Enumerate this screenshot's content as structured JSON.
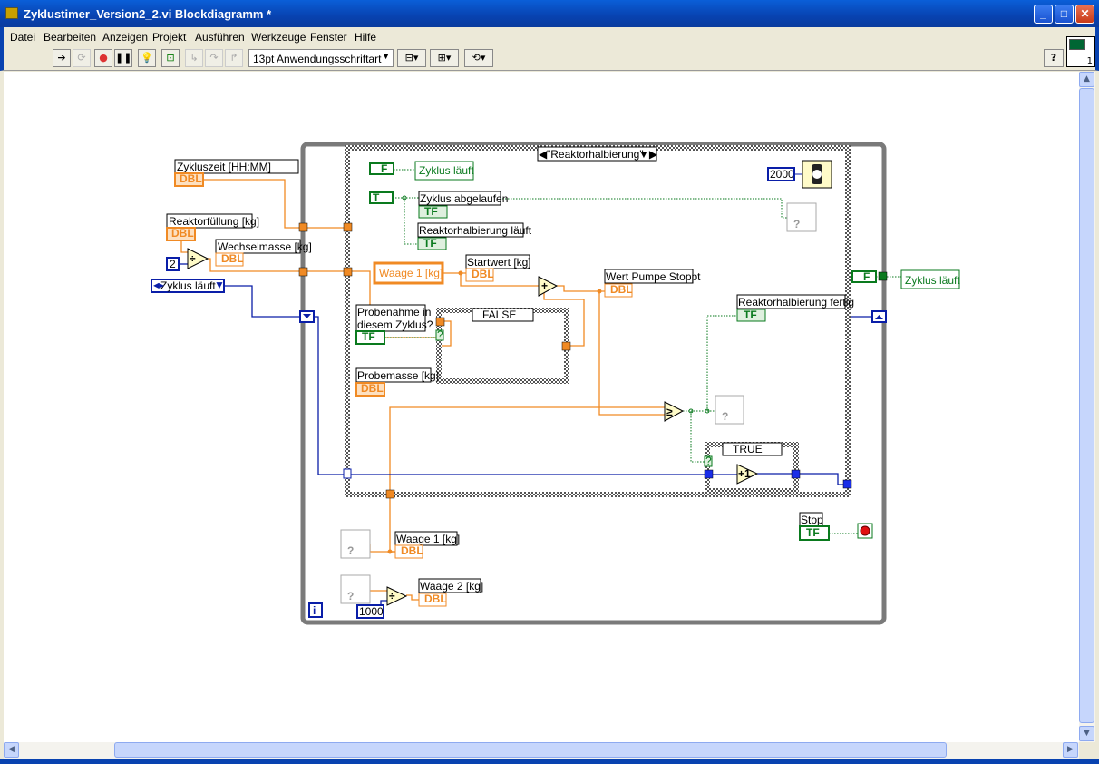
{
  "window": {
    "title": "Zyklustimer_Version2_2.vi Blockdiagramm *",
    "minimize": "_",
    "maximize": "□",
    "close": "✕"
  },
  "menu": [
    "Datei",
    "Bearbeiten",
    "Anzeigen",
    "Projekt",
    "Ausführen",
    "Werkzeuge",
    "Fenster",
    "Hilfe"
  ],
  "toolbar": {
    "font": "13pt Anwendungsschriftart",
    "help": "?",
    "connector_pane_number": "1",
    "icons": [
      "run-arrow-icon",
      "run-continuously-icon",
      "abort-icon",
      "pause-icon",
      "highlight-execution-icon",
      "retain-wire-values-icon",
      "step-into-icon",
      "step-over-icon",
      "step-out-icon",
      "align-icon",
      "distribute-icon",
      "reorder-icon"
    ]
  },
  "diagram": {
    "case_selector": "\"Reaktorhalbierung\"",
    "inner_case_false": "FALSE",
    "inner_case_true": "TRUE",
    "labels": {
      "zykluszeit": "Zykluszeit [HH:MM]",
      "reaktorfuellung": "Reaktorfüllung [kg]",
      "wechselmasse": "Wechselmasse [kg]",
      "zyklus_laeuft_enum": "Zyklus läuft",
      "zyklus_laeuft_local": "Zyklus läuft",
      "zyklus_abgelaufen": "Zyklus abgelaufen",
      "reaktorhalbierung_laeuft": "Reaktorhalbierung läuft",
      "waage1_local": "Waage 1 [kg]",
      "startwert": "Startwert [kg]",
      "wert_pumpe_stoppt": "Wert Pumpe Stoppt",
      "probenahme_1": "Probenahme in",
      "probenahme_2": "diesem Zyklus?",
      "probemasse": "Probemasse [kg]",
      "reaktorhalbierung_fertig": "Reaktorhalbierung fertig",
      "zyklus_laeuft_out": "Zyklus läuft",
      "stop": "Stop",
      "waage1": "Waage 1 [kg]",
      "waage2": "Waage 2 [kg]"
    },
    "constants": {
      "two": "2",
      "wait_ms": "2000",
      "thousand": "1000",
      "iteration": "i"
    },
    "terminals": {
      "dbl": "DBL",
      "tf": "TF",
      "f": "F",
      "t": "T",
      "unknown": "?",
      "plus": "+",
      "plus_one": "+1",
      "divide": "÷",
      "gte": "≥"
    },
    "colors": {
      "double": "#f08a24",
      "boolean": "#0a7a1e",
      "integer": "#0a1ea8",
      "structure": "#7a7a7a"
    }
  }
}
